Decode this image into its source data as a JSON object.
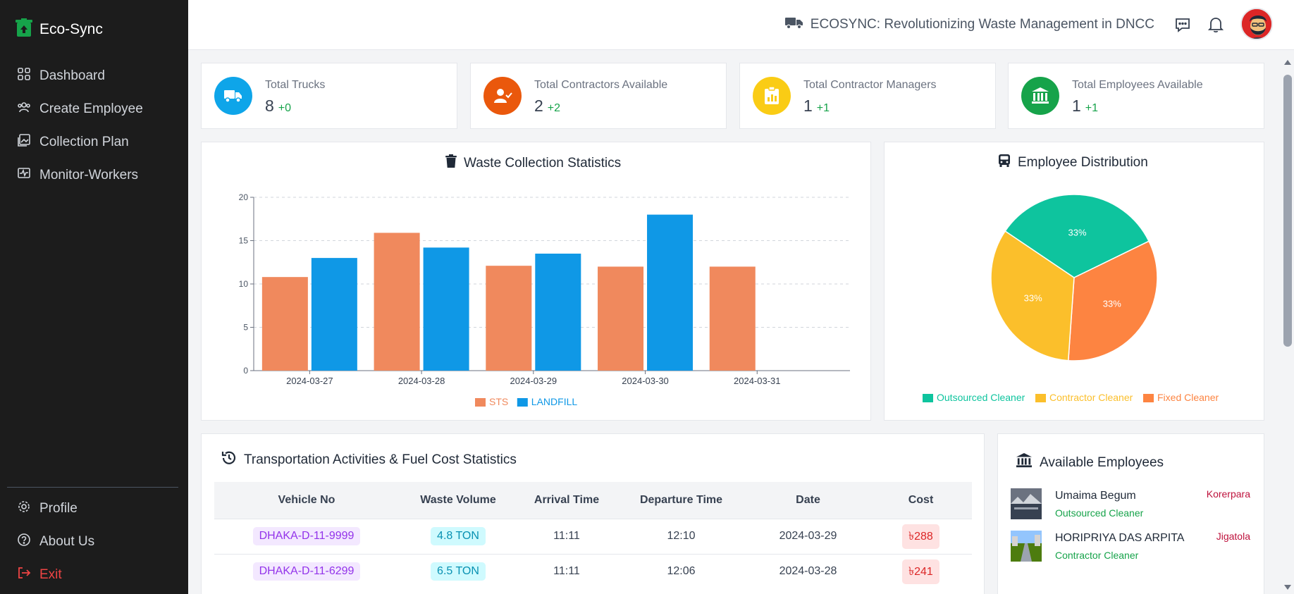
{
  "brand": {
    "name": "Eco-Sync"
  },
  "nav": {
    "items": [
      {
        "label": "Dashboard",
        "icon": "grid-icon"
      },
      {
        "label": "Create Employee",
        "icon": "users-icon"
      },
      {
        "label": "Collection Plan",
        "icon": "image-icon"
      },
      {
        "label": "Monitor-Workers",
        "icon": "monitor-icon"
      }
    ],
    "bottom": [
      {
        "label": "Profile",
        "icon": "gear-icon"
      },
      {
        "label": "About Us",
        "icon": "help-icon"
      },
      {
        "label": "Exit",
        "icon": "logout-icon"
      }
    ]
  },
  "header": {
    "title": "ECOSYNC: Revolutionizing Waste Management in DNCC"
  },
  "stats": [
    {
      "label": "Total Trucks",
      "value": "8",
      "delta": "+0",
      "color": "#0ea5e9",
      "icon": "truck-icon"
    },
    {
      "label": "Total Contractors Available",
      "value": "2",
      "delta": "+2",
      "color": "#ea580c",
      "icon": "user-check-icon"
    },
    {
      "label": "Total Contractor Managers",
      "value": "1",
      "delta": "+1",
      "color": "#facc15",
      "icon": "clipboard-chart-icon"
    },
    {
      "label": "Total Employees Available",
      "value": "1",
      "delta": "+1",
      "color": "#16a34a",
      "icon": "bank-icon"
    }
  ],
  "waste_chart": {
    "title": "Waste Collection Statistics",
    "legend": [
      "STS",
      "LANDFILL"
    ]
  },
  "employee_chart": {
    "title": "Employee Distribution",
    "legend": [
      "Outsourced Cleaner",
      "Contractor Cleaner",
      "Fixed Cleaner"
    ]
  },
  "chart_data": [
    {
      "type": "bar",
      "title": "Waste Collection Statistics",
      "categories": [
        "2024-03-27",
        "2024-03-28",
        "2024-03-29",
        "2024-03-30",
        "2024-03-31"
      ],
      "series": [
        {
          "name": "STS",
          "values": [
            10.8,
            15.9,
            12.1,
            12.0,
            12.0
          ],
          "color": "#f0895d"
        },
        {
          "name": "LANDFILL",
          "values": [
            13.0,
            14.2,
            13.5,
            18.0,
            0
          ],
          "color": "#0f98e6"
        }
      ],
      "ylim": [
        0,
        20
      ],
      "yticks": [
        "0",
        "5",
        "10",
        "15",
        "20"
      ],
      "grid": true,
      "legend_position": "bottom"
    },
    {
      "type": "pie",
      "title": "Employee Distribution",
      "categories": [
        "Outsourced Cleaner",
        "Contractor Cleaner",
        "Fixed Cleaner"
      ],
      "values": [
        33.33,
        33.33,
        33.33
      ],
      "labels": [
        "33%",
        "33%",
        "33%"
      ],
      "colors": [
        "#0ec49e",
        "#fbbf2b",
        "#fd8441"
      ],
      "legend_position": "bottom"
    }
  ],
  "transport": {
    "title": "Transportation Activities & Fuel Cost Statistics",
    "columns": [
      "Vehicle No",
      "Waste Volume",
      "Arrival Time",
      "Departure Time",
      "Date",
      "Cost"
    ],
    "rows": [
      {
        "vehicle": "DHAKA-D-11-9999",
        "volume": "4.8 TON",
        "arrival": "11:11",
        "departure": "12:10",
        "date": "2024-03-29",
        "cost": "৳288"
      },
      {
        "vehicle": "DHAKA-D-11-6299",
        "volume": "6.5 TON",
        "arrival": "11:11",
        "departure": "12:06",
        "date": "2024-03-28",
        "cost": "৳241"
      }
    ]
  },
  "employees": {
    "title": "Available Employees",
    "items": [
      {
        "name": "Umaima Begum",
        "role": "Outsourced Cleaner",
        "location": "Korerpara"
      },
      {
        "name": "HORIPRIYA DAS ARPITA",
        "role": "Contractor Cleaner",
        "location": "Jigatola"
      }
    ]
  }
}
